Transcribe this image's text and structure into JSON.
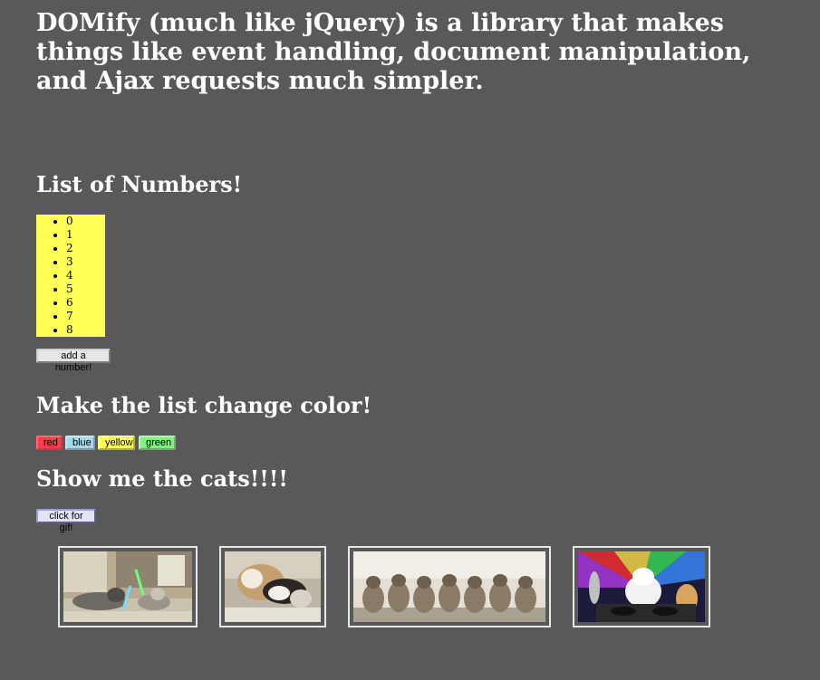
{
  "intro": {
    "text": "DOMify (much like jQuery) is a library that makes things like event handling, document manipulation, and Ajax requests much simpler."
  },
  "numbers_section": {
    "title": "List of Numbers!",
    "items": [
      "0",
      "1",
      "2",
      "3",
      "4",
      "5",
      "6",
      "7",
      "8"
    ],
    "list_color": "#ffff55",
    "add_button_label": "add a number!"
  },
  "color_section": {
    "title": "Make the list change color!",
    "buttons": [
      {
        "label": "red",
        "color": "#ff3b4b"
      },
      {
        "label": "blue",
        "color": "#a9d8ea"
      },
      {
        "label": "yellow",
        "color": "#ffff55"
      },
      {
        "label": "green",
        "color": "#7ff27f"
      }
    ]
  },
  "cats_section": {
    "title": "Show me the cats!!!!",
    "gif_button_label": "click for gif!",
    "gifs": [
      {
        "icon": "cat-lightsaber-image"
      },
      {
        "icon": "cats-cuddling-image"
      },
      {
        "icon": "kittens-row-image"
      },
      {
        "icon": "dj-cat-image"
      }
    ]
  },
  "colors": {
    "background": "#595959",
    "heading_text": "#ffffff"
  }
}
